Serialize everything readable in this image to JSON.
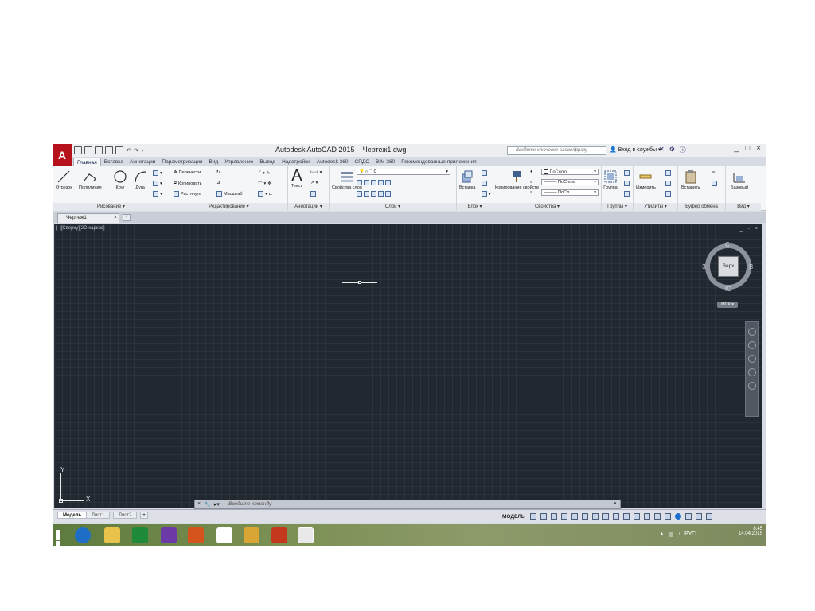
{
  "window": {
    "title": "Autodesk AutoCAD 2015",
    "file_name": "Чертеж1.dwg",
    "search_placeholder": "Введите ключевое слово/фразу",
    "signin_label": "Вход в службы",
    "controls": [
      "_",
      "□",
      "×"
    ]
  },
  "ribbon": {
    "tabs": [
      "Главная",
      "Вставка",
      "Аннотации",
      "Параметризация",
      "Вид",
      "Управление",
      "Вывод",
      "Надстройки",
      "Autodesk 360",
      "СПДС",
      "BIM 360",
      "Рекомендованные приложения"
    ],
    "active_tab": "Главная",
    "panels": {
      "draw": {
        "label": "Рисование",
        "tools": [
          "Отрезок",
          "Полилиния",
          "Круг",
          "Дуга"
        ]
      },
      "modify": {
        "label": "Редактирование",
        "tools": [
          "Перенести",
          "Копировать",
          "Растянуть",
          "Масштаб"
        ]
      },
      "annotation": {
        "label": "Аннотации",
        "tool": "Текст"
      },
      "layers": {
        "label": "Слои",
        "tool": "Свойства слоя",
        "current_layer": "0"
      },
      "block": {
        "label": "Блок",
        "tool": "Вставка"
      },
      "properties": {
        "label": "Свойства",
        "tool": "Копирование свойств",
        "color": "ПоСлою",
        "linetype": "ПоСлою",
        "lineweight": "ПоСл..."
      },
      "groups": {
        "label": "Группы",
        "tool": "Группа"
      },
      "utilities": {
        "label": "Утилиты",
        "tool": "Измерить"
      },
      "clipboard": {
        "label": "Буфер обмена",
        "tool": "Вставить"
      },
      "view": {
        "label": "Вид",
        "tool": "Базовый"
      }
    }
  },
  "document": {
    "tab_label": "Чертеж1"
  },
  "viewport": {
    "label": "[–][Сверху][2D-каркас]",
    "viewcube": {
      "face": "Верх",
      "north": "С",
      "south": "Ю",
      "east": "В",
      "west": "З",
      "wcs": "МСК"
    },
    "ucs": {
      "x": "X",
      "y": "Y"
    }
  },
  "command_line": {
    "placeholder": "Введите команду"
  },
  "layouts": {
    "tabs": [
      "Модель",
      "Лист1",
      "Лист2"
    ],
    "active": "Модель"
  },
  "status": {
    "space": "МОДЕЛЬ"
  },
  "taskbar": {
    "language": "РУС",
    "time": "8:45",
    "date": "14.04.2015"
  }
}
